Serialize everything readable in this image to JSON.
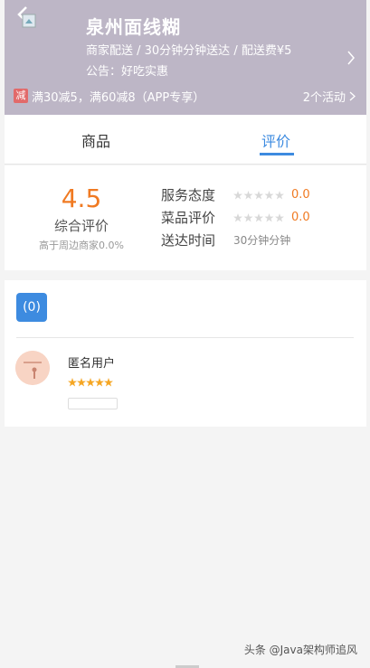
{
  "header": {
    "shop_name": "泉州面线糊",
    "delivery_info": "商家配送 / 30分钟分钟送达 / 配送费¥5",
    "notice": "公告：好吃实惠",
    "promo_badge": "减",
    "promo_text": "满30减5，满60减8（APP专享）",
    "activity_count": "2个活动"
  },
  "tabs": [
    {
      "label": "商品"
    },
    {
      "label": "评价"
    }
  ],
  "summary": {
    "overall_score": "4.5",
    "overall_label": "综合评价",
    "overall_sub": "高于周边商家0.0%",
    "service_label": "服务态度",
    "service_score": "0.0",
    "food_label": "菜品评价",
    "food_score": "0.0",
    "delivery_label": "送达时间",
    "delivery_time": "30分钟分钟"
  },
  "reviews": {
    "count_label": "(0)",
    "items": [
      {
        "user": "匿名用户",
        "rating": 5
      }
    ]
  },
  "footer": {
    "watermark": "头条 @Java架构师追风"
  }
}
